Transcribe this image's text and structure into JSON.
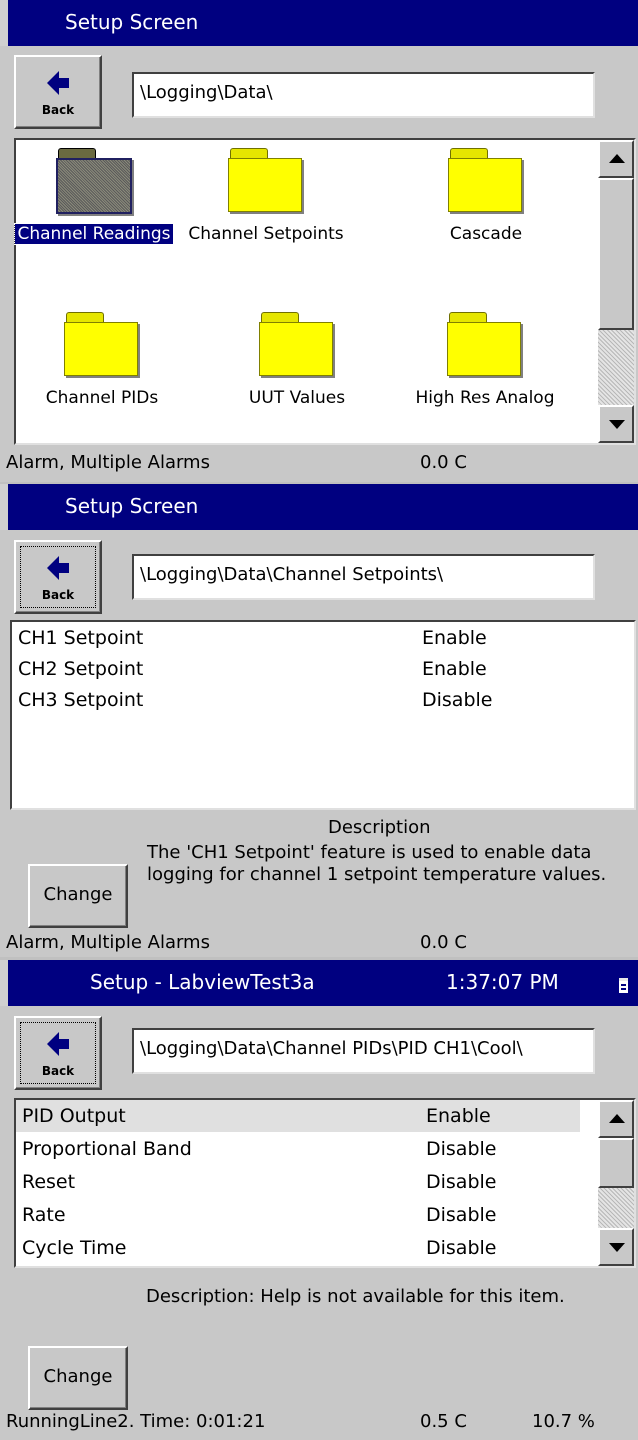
{
  "panels": [
    {
      "title": "Setup Screen",
      "back_label": "Back",
      "path": "\\Logging\\Data\\",
      "folders": [
        {
          "label": "Channel Readings",
          "selected": true
        },
        {
          "label": "Channel Setpoints",
          "selected": false
        },
        {
          "label": "Cascade",
          "selected": false
        },
        {
          "label": "Channel PIDs",
          "selected": false
        },
        {
          "label": "UUT Values",
          "selected": false
        },
        {
          "label": "High Res Analog",
          "selected": false
        }
      ],
      "status": {
        "left": "Alarm, Multiple Alarms",
        "temp": "0.0 C"
      }
    },
    {
      "title": "Setup Screen",
      "back_label": "Back",
      "path": "\\Logging\\Data\\Channel Setpoints\\",
      "rows": [
        {
          "name": "CH1 Setpoint",
          "value": "Enable"
        },
        {
          "name": "CH2 Setpoint",
          "value": "Enable"
        },
        {
          "name": "CH3 Setpoint",
          "value": "Disable"
        }
      ],
      "description_title": "Description",
      "description_text": "The 'CH1 Setpoint' feature is used to enable data logging for channel 1 setpoint temperature values.",
      "change_label": "Change",
      "status": {
        "left": "Alarm, Multiple Alarms",
        "temp": "0.0 C"
      }
    },
    {
      "title": "Setup - LabviewTest3a",
      "clock": "1:37:07 PM",
      "back_label": "Back",
      "path": "\\Logging\\Data\\Channel PIDs\\PID CH1\\Cool\\",
      "rows": [
        {
          "name": "PID Output",
          "value": "Enable"
        },
        {
          "name": "Proportional Band",
          "value": "Disable"
        },
        {
          "name": "Reset",
          "value": "Disable"
        },
        {
          "name": "Rate",
          "value": "Disable"
        },
        {
          "name": "Cycle Time",
          "value": "Disable"
        }
      ],
      "description": "Description:  Help is not available for this item.",
      "change_label": "Change",
      "status": {
        "left": "RunningLine2.  Time: 0:01:21",
        "temp": "0.5 C",
        "percent": "10.7 %"
      }
    }
  ],
  "icons": {
    "back": "back-arrow-icon",
    "folder": "folder-icon",
    "tray": "tray-icon",
    "scroll_up": "scroll-up-icon",
    "scroll_down": "scroll-down-icon"
  },
  "colors": {
    "titlebar": "#000080",
    "folder": "#ffff00",
    "selection": "#000080",
    "background": "#c8c8c8"
  }
}
